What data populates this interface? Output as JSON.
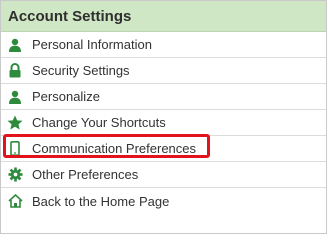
{
  "panel": {
    "title": "Account Settings"
  },
  "menu": {
    "items": [
      {
        "label": "Personal Information",
        "icon": "user-icon"
      },
      {
        "label": "Security Settings",
        "icon": "lock-icon"
      },
      {
        "label": "Personalize",
        "icon": "user-icon"
      },
      {
        "label": "Change Your Shortcuts",
        "icon": "star-icon"
      },
      {
        "label": "Communication Preferences",
        "icon": "mobile-phone-icon",
        "highlighted": true
      },
      {
        "label": "Other Preferences",
        "icon": "gear-icon"
      },
      {
        "label": "Back to the Home Page",
        "icon": "home-icon"
      }
    ]
  },
  "colors": {
    "header_bg": "#cfe7c5",
    "icon_green": "#2e8b3d",
    "highlight_red": "#e3131b"
  }
}
